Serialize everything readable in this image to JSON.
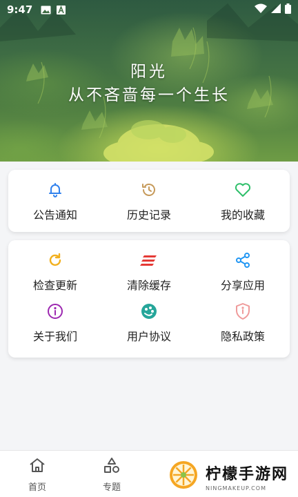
{
  "status_bar": {
    "time": "9:47",
    "icons": [
      "image-icon",
      "font-icon",
      "wifi-icon",
      "signal-icon",
      "battery-icon"
    ]
  },
  "hero": {
    "line1": "阳光",
    "line2": "从不吝啬每一个生长"
  },
  "card1": {
    "items": [
      {
        "label": "公告通知",
        "icon": "bell-icon",
        "color": "#2f80ed"
      },
      {
        "label": "历史记录",
        "icon": "history-icon",
        "color": "#c69a5a"
      },
      {
        "label": "我的收藏",
        "icon": "heart-icon",
        "color": "#2ebf6a"
      }
    ]
  },
  "card2": {
    "items": [
      {
        "label": "检查更新",
        "icon": "refresh-icon",
        "color": "#f2b01e"
      },
      {
        "label": "清除缓存",
        "icon": "clear-lines-icon",
        "color": "#e53935"
      },
      {
        "label": "分享应用",
        "icon": "share-icon",
        "color": "#2196f3"
      },
      {
        "label": "关于我们",
        "icon": "info-icon",
        "color": "#9c27b0"
      },
      {
        "label": "用户协议",
        "icon": "palette-icon",
        "color": "#26a69a"
      },
      {
        "label": "隐私政策",
        "icon": "shield-icon",
        "color": "#ef9a9a"
      }
    ]
  },
  "bottom_nav": {
    "items": [
      {
        "label": "首页",
        "icon": "home-icon"
      },
      {
        "label": "专题",
        "icon": "shapes-icon"
      },
      {
        "label": "",
        "icon": "circle-icon"
      },
      {
        "label": "",
        "icon": "person-icon"
      }
    ]
  },
  "watermark": {
    "title": "柠檬手游网",
    "subtitle": "NINGMAKEUP.COM"
  }
}
